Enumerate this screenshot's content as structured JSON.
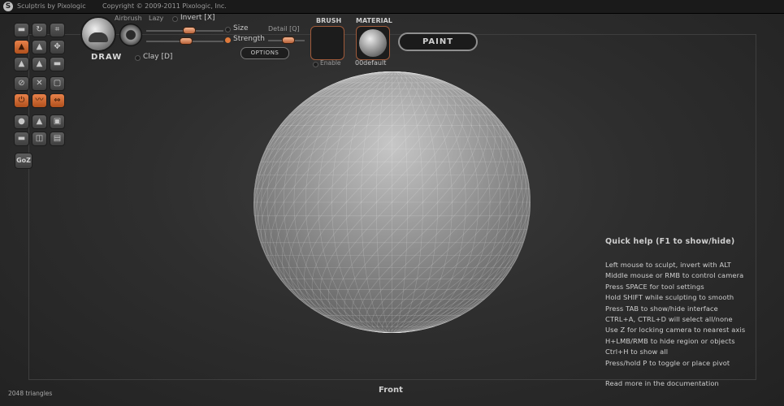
{
  "title": {
    "app": "Sculptris by Pixologic",
    "copyright": "Copyright © 2009-2011 Pixologic, Inc."
  },
  "toolbar": {
    "group1": [
      "grab-icon",
      "rotate-icon",
      "crop-icon",
      "draw-tool-icon",
      "flatten-icon",
      "move-icon",
      "inflate-icon",
      "pinch-icon",
      "smooth-icon"
    ],
    "group2": [
      "rotate-view-icon",
      "scale-icon",
      "frame-icon",
      "power-icon",
      "crease-icon",
      "symmetry-icon"
    ],
    "group3": [
      "sphere-icon",
      "sculpt-icon",
      "mask-icon",
      "plane-icon",
      "hide-icon",
      "save-icon"
    ],
    "goz": "GoZ",
    "accent": "#e07a3c"
  },
  "brush": {
    "draw": "DRAW",
    "airbrush": "Airbrush",
    "lazy": "Lazy",
    "invert": "Invert [X]",
    "clay": "Clay [D]",
    "size": "Size",
    "strength": "Strength",
    "detail": "Detail [Q]",
    "options": "OPTIONS",
    "size_level": 0.55,
    "strength_level": 0.5
  },
  "brush_panel": {
    "title": "BRUSH",
    "enable": "Enable"
  },
  "material_panel": {
    "title": "MATERIAL",
    "name": "00default"
  },
  "paint_button": "PAINT",
  "help": {
    "title": "Quick help (F1 to show/hide)",
    "lines": [
      "Left mouse to sculpt, invert with ALT",
      "Middle mouse or RMB to control camera",
      "Press SPACE for tool settings",
      "Hold SHIFT while sculpting to smooth",
      "Press TAB to show/hide interface",
      "CTRL+A, CTRL+D will select all/none",
      "Use Z for locking camera to nearest axis",
      "H+LMB/RMB to hide region or objects",
      "Ctrl+H to show all",
      "Press/hold P to toggle or place pivot"
    ],
    "more": "Read more in the documentation"
  },
  "status": {
    "triangles": "2048 triangles",
    "view": "Front"
  }
}
